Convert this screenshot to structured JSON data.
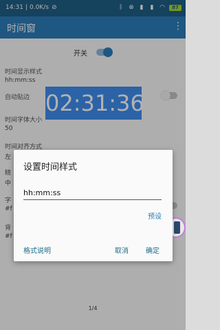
{
  "status_bar": {
    "time": "14:31",
    "speed": "0.0K/s",
    "battery": "87"
  },
  "app_bar": {
    "title": "时间窗",
    "menu_icon": "more-vert-icon"
  },
  "master": {
    "label": "开关",
    "on": true
  },
  "settings": [
    {
      "label": "时间显示样式",
      "value": "hh:mm:ss"
    },
    {
      "label": "自动贴边",
      "value": ""
    },
    {
      "label": "时间字体大小",
      "value": "50"
    },
    {
      "label": "时间对齐方式",
      "value": "左"
    },
    {
      "label": "精",
      "value": "中"
    },
    {
      "label": "字",
      "value": "#f"
    },
    {
      "label": "背",
      "value": "#f"
    }
  ],
  "preview_time": "02:31:36",
  "colors": {
    "status_bar": "#1f5f86",
    "app_bar": "#2b7dbb",
    "accent": "#2b7dbb",
    "preview_bg": "#3f8ff0"
  },
  "dialog": {
    "title": "设置时间样式",
    "input_value": "hh:mm:ss",
    "preset": "预设",
    "help": "格式说明",
    "cancel": "取消",
    "ok": "确定"
  },
  "pager": "1/4"
}
